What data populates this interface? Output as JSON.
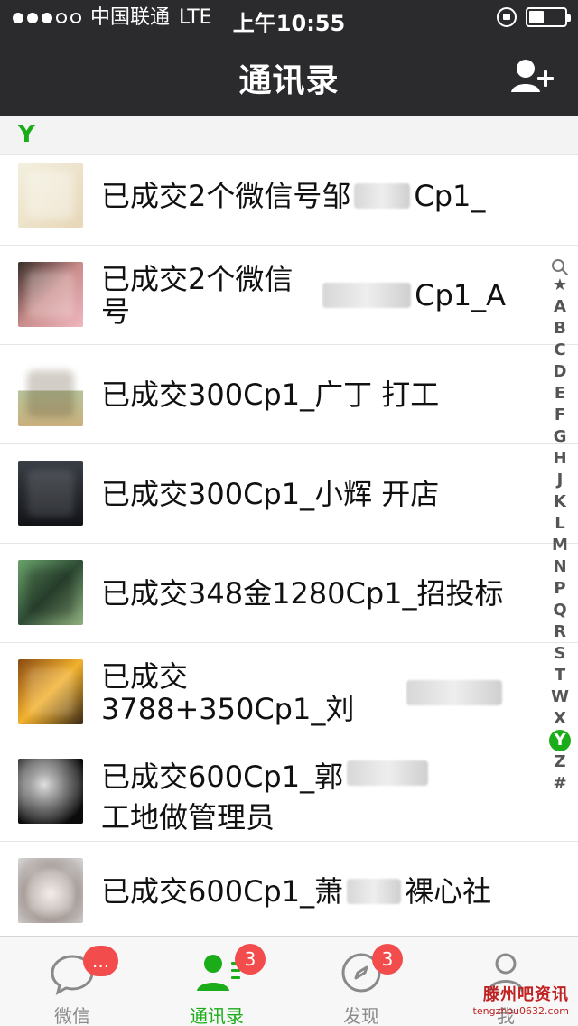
{
  "status_bar": {
    "carrier": "中国联通",
    "network": "LTE",
    "time": "上午10:55"
  },
  "nav": {
    "title": "通讯录"
  },
  "section": {
    "letter": "Y"
  },
  "contacts": [
    {
      "name_prefix": "已成交2个微信号邹",
      "name_suffix": "Cp1_"
    },
    {
      "name_prefix": "已成交2个微信号",
      "name_suffix": "Cp1_A"
    },
    {
      "name_prefix": "已成交300Cp1_广丁 打工",
      "name_suffix": ""
    },
    {
      "name_prefix": "已成交300Cp1_小辉 开店",
      "name_suffix": ""
    },
    {
      "name_prefix": "已成交348金1280Cp1_招投标",
      "name_suffix": ""
    },
    {
      "name_prefix": "已成交3788+350Cp1_刘",
      "name_suffix": ""
    },
    {
      "name_prefix": "已成交600Cp1_郭",
      "name_suffix": " 工地做管理员"
    },
    {
      "name_prefix": "已成交600Cp1_萧",
      "name_suffix": " 裸心社"
    }
  ],
  "index": {
    "letters": [
      "★",
      "A",
      "B",
      "C",
      "D",
      "E",
      "F",
      "G",
      "H",
      "J",
      "K",
      "L",
      "M",
      "N",
      "P",
      "Q",
      "R",
      "S",
      "T",
      "W",
      "X",
      "Y",
      "Z",
      "#"
    ],
    "selected": "Y",
    "search_icon": "search-icon"
  },
  "tabs": [
    {
      "label": "微信",
      "badge": "...",
      "icon": "chat-icon",
      "active": false
    },
    {
      "label": "通讯录",
      "badge": "3",
      "icon": "contacts-icon",
      "active": true
    },
    {
      "label": "发现",
      "badge": "3",
      "icon": "compass-icon",
      "active": false
    },
    {
      "label": "我",
      "badge": "",
      "icon": "profile-icon",
      "active": false
    }
  ],
  "watermark": {
    "line1": "滕州吧资讯",
    "line2": "tengzhou0632.com"
  },
  "colors": {
    "accent": "#1aad19",
    "header_bg": "#2b2b2e",
    "badge": "#f24c4c"
  }
}
